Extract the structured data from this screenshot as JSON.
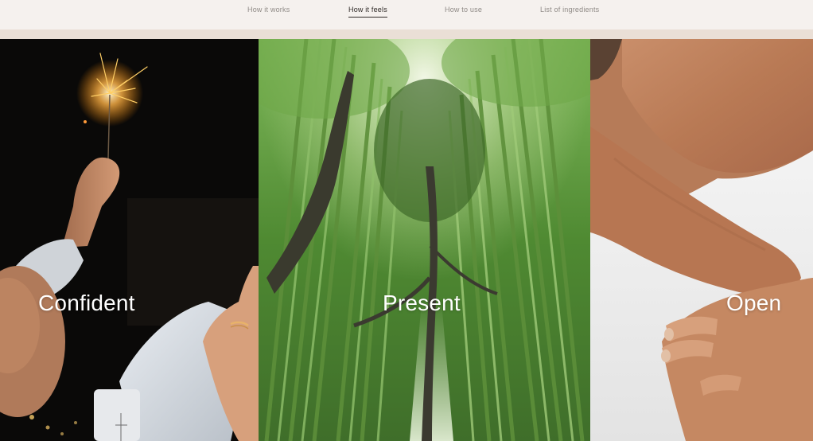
{
  "nav": {
    "tabs": [
      {
        "label": "How it works",
        "active": false
      },
      {
        "label": "How it feels",
        "active": true
      },
      {
        "label": "How to use",
        "active": false
      },
      {
        "label": "List of ingredients",
        "active": false
      }
    ]
  },
  "panels": [
    {
      "label": "Confident",
      "image": "sparkler-celebration-photo"
    },
    {
      "label": "Present",
      "image": "bamboo-forest-photo"
    },
    {
      "label": "Open",
      "image": "arms-skin-closeup-photo"
    }
  ],
  "colors": {
    "background": "#f5f1ee",
    "divider": "#eadfd6",
    "nav_inactive": "#8f8a86",
    "nav_active": "#2f2a27",
    "label_text": "#ffffff"
  }
}
